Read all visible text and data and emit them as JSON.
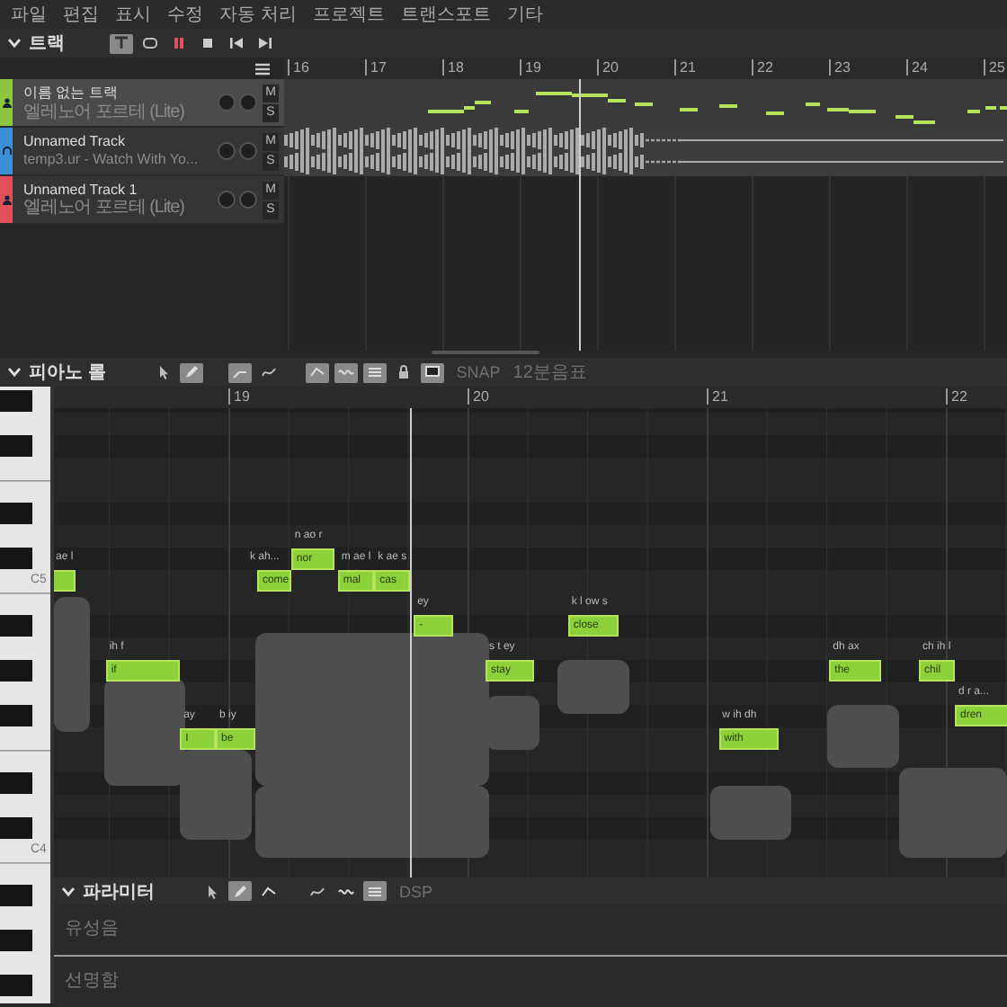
{
  "menu": [
    "파일",
    "편집",
    "표시",
    "수정",
    "자동 처리",
    "프로젝트",
    "트랜스포트",
    "기타"
  ],
  "tracks_panel": {
    "title": "트랙",
    "transport": [
      {
        "kind": "snap",
        "selected": true
      },
      {
        "kind": "loop",
        "selected": false
      },
      {
        "kind": "pause",
        "selected": false
      },
      {
        "kind": "stop",
        "selected": false
      },
      {
        "kind": "to-start",
        "selected": false
      },
      {
        "kind": "to-end",
        "selected": false
      }
    ],
    "measures": [
      "16",
      "17",
      "18",
      "19",
      "20",
      "21",
      "22",
      "23",
      "24",
      "25"
    ],
    "tracks": [
      {
        "name": "이름 없는 트랙",
        "source": "엘레노어 포르테 (Lite)",
        "color": "#8dc63f",
        "kind": "voice",
        "selected": true,
        "mute": "M",
        "solo": "S"
      },
      {
        "name": "Unnamed Track",
        "source": "temp3.ur - Watch With Yo...",
        "color": "#3b8fd6",
        "kind": "audio",
        "selected": false,
        "mute": "M",
        "solo": "S"
      },
      {
        "name": "Unnamed Track 1",
        "source": "엘레노어 포르테 (Lite)",
        "color": "#e0505a",
        "kind": "voice",
        "selected": false,
        "mute": "M",
        "solo": "S"
      }
    ]
  },
  "piano_roll": {
    "title": "피아노 롤",
    "tools": [
      {
        "kind": "pointer",
        "selected": false
      },
      {
        "kind": "pencil",
        "selected": true
      },
      {
        "kind": "note",
        "selected": true
      },
      {
        "kind": "curve",
        "selected": false
      },
      {
        "kind": "line",
        "selected": true
      },
      {
        "kind": "wave",
        "selected": true
      },
      {
        "kind": "grid",
        "selected": true
      },
      {
        "kind": "lock",
        "selected": false
      },
      {
        "kind": "monitor",
        "selected": true
      }
    ],
    "snap": "SNAP",
    "quantize": "12분음표",
    "measures": [
      "19",
      "20",
      "21",
      "22"
    ],
    "key_labels": [
      "C5",
      "C4"
    ],
    "notes": [
      {
        "phoneme": "ae l"
      },
      {
        "phoneme": "ih f",
        "lyric": "if"
      },
      {
        "phoneme": "ay",
        "lyric": "I"
      },
      {
        "phoneme": "b iy",
        "lyric": "be"
      },
      {
        "phoneme": "k ah...",
        "lyric": "come"
      },
      {
        "phoneme": "n ao r",
        "lyric": "nor"
      },
      {
        "phoneme": "m ae l",
        "lyric": "mal"
      },
      {
        "phoneme": "k ae s",
        "lyric": "cas"
      },
      {
        "phoneme": "ey",
        "lyric": "-"
      },
      {
        "phoneme": "s t ey",
        "lyric": "stay"
      },
      {
        "phoneme": "k l ow s",
        "lyric": "close"
      },
      {
        "phoneme": "w ih dh",
        "lyric": "with"
      },
      {
        "phoneme": "dh ax",
        "lyric": "the"
      },
      {
        "phoneme": "ch ih l",
        "lyric": "chil"
      },
      {
        "phoneme": "d r a...",
        "lyric": "dren"
      }
    ]
  },
  "parameters": {
    "title": "파라미터",
    "tools": [
      {
        "kind": "pointer",
        "selected": false
      },
      {
        "kind": "pencil",
        "selected": true
      },
      {
        "kind": "line",
        "selected": false
      },
      {
        "kind": "curve",
        "selected": false
      },
      {
        "kind": "wave",
        "selected": false
      },
      {
        "kind": "grid",
        "selected": true
      }
    ],
    "texts": [
      "DSP"
    ],
    "lanes": [
      "유성음",
      "선명함"
    ]
  }
}
